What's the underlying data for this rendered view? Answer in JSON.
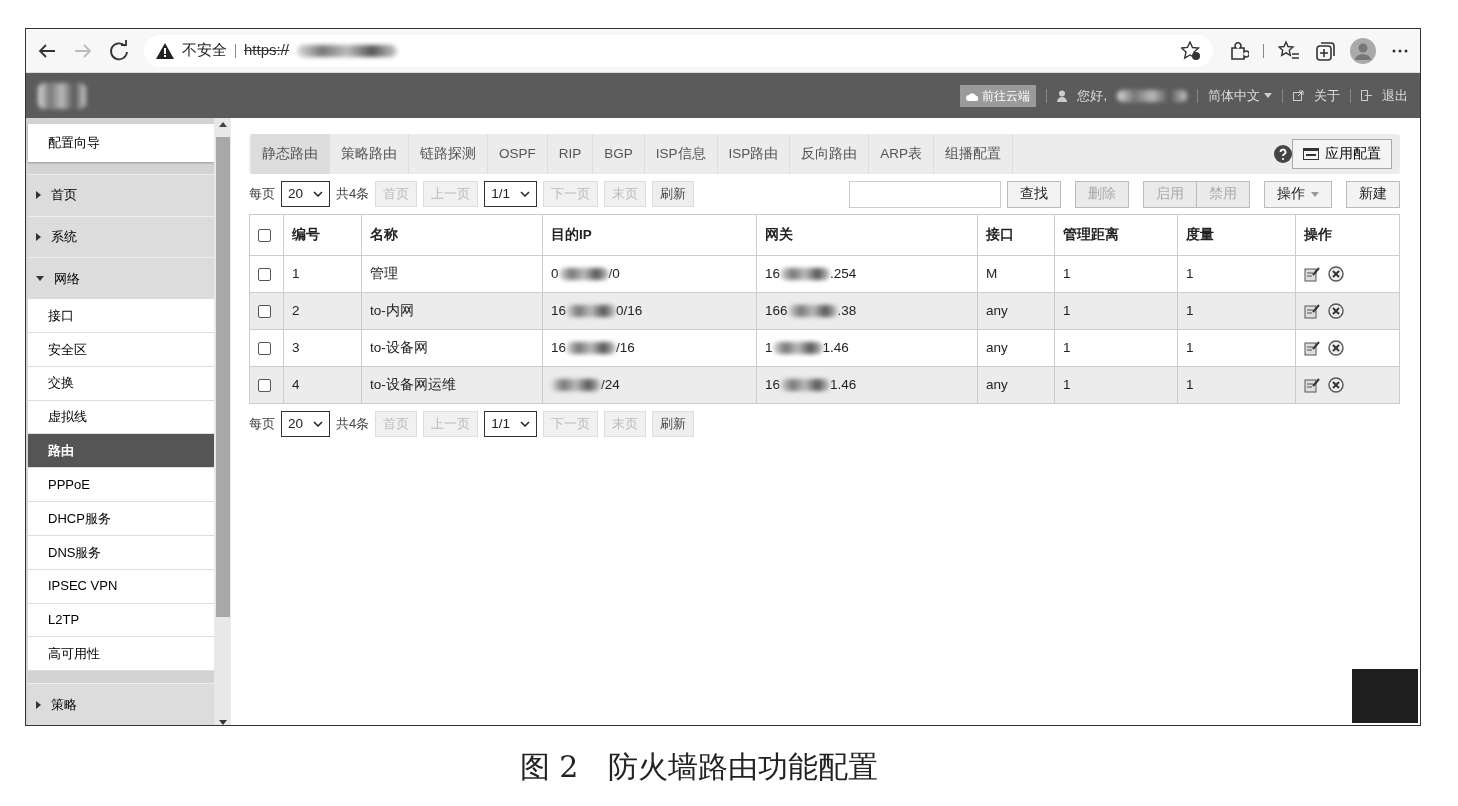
{
  "browser": {
    "forward_disabled": true,
    "security_label": "不安全",
    "url": "https://"
  },
  "header": {
    "cloud_button": "前往云端",
    "greeting": "您好,",
    "language": "简体中文",
    "about": "关于",
    "logout": "退出"
  },
  "sidebar": {
    "items": [
      {
        "label": "配置向导",
        "kind": "wizard"
      },
      {
        "label": "首页",
        "kind": "group",
        "expanded": false
      },
      {
        "label": "系统",
        "kind": "group",
        "expanded": false
      },
      {
        "label": "网络",
        "kind": "group",
        "expanded": true,
        "children": [
          {
            "label": "接口",
            "selected": false
          },
          {
            "label": "安全区",
            "selected": false
          },
          {
            "label": "交换",
            "selected": false
          },
          {
            "label": "虚拟线",
            "selected": false
          },
          {
            "label": "路由",
            "selected": true
          },
          {
            "label": "PPPoE",
            "selected": false
          },
          {
            "label": "DHCP服务",
            "selected": false
          },
          {
            "label": "DNS服务",
            "selected": false
          },
          {
            "label": "IPSEC VPN",
            "selected": false
          },
          {
            "label": "L2TP",
            "selected": false
          },
          {
            "label": "高可用性",
            "selected": false
          }
        ]
      },
      {
        "label": "策略",
        "kind": "group",
        "expanded": false
      }
    ]
  },
  "tabs": [
    {
      "label": "静态路由",
      "selected": true
    },
    {
      "label": "策略路由",
      "selected": false
    },
    {
      "label": "链路探测",
      "selected": false
    },
    {
      "label": "OSPF",
      "selected": false
    },
    {
      "label": "RIP",
      "selected": false
    },
    {
      "label": "BGP",
      "selected": false
    },
    {
      "label": "ISP信息",
      "selected": false
    },
    {
      "label": "ISP路由",
      "selected": false
    },
    {
      "label": "反向路由",
      "selected": false
    },
    {
      "label": "ARP表",
      "selected": false
    },
    {
      "label": "组播配置",
      "selected": false
    }
  ],
  "apply_button": "应用配置",
  "pagers": [
    {
      "per_page_label": "每页",
      "per_page": "20",
      "total": "共4条",
      "page": "1/1",
      "buttons": [
        {
          "label": "首页",
          "disabled": true
        },
        {
          "label": "上一页",
          "disabled": true
        },
        {
          "label": "下一页",
          "disabled": true
        },
        {
          "label": "末页",
          "disabled": true
        },
        {
          "label": "刷新",
          "disabled": false
        }
      ]
    },
    {
      "per_page_label": "每页",
      "per_page": "20",
      "total": "共4条",
      "page": "1/1",
      "buttons": [
        {
          "label": "首页",
          "disabled": true
        },
        {
          "label": "上一页",
          "disabled": true
        },
        {
          "label": "下一页",
          "disabled": true
        },
        {
          "label": "末页",
          "disabled": true
        },
        {
          "label": "刷新",
          "disabled": false
        }
      ]
    }
  ],
  "actions": [
    {
      "label": "查找",
      "disabled": false,
      "kind": "button"
    },
    {
      "label": "删除",
      "disabled": true,
      "kind": "button"
    },
    {
      "label": "启用",
      "disabled": true,
      "kind": "group"
    },
    {
      "label": "禁用",
      "disabled": true,
      "kind": "group"
    },
    {
      "label": "操作",
      "disabled": false,
      "kind": "dropdown"
    },
    {
      "label": "新建",
      "disabled": false,
      "kind": "button"
    }
  ],
  "table": {
    "select_all_checked": false,
    "columns": [
      "编号",
      "名称",
      "目的IP",
      "网关",
      "接口",
      "管理距离",
      "度量",
      "操作"
    ],
    "rows": [
      {
        "checked": false,
        "number": "1",
        "name": "管理",
        "destination": {
          "start": "0",
          "end": "/0"
        },
        "gateway": {
          "start": "16",
          "end": ".254"
        },
        "interface": "M",
        "distance": "1",
        "metric": "1"
      },
      {
        "checked": false,
        "number": "2",
        "name": "to-内网",
        "destination": {
          "start": "16",
          "end": "0/16"
        },
        "gateway": {
          "start": "166",
          "end": ".38"
        },
        "interface": "any",
        "distance": "1",
        "metric": "1"
      },
      {
        "checked": false,
        "number": "3",
        "name": "to-设备网",
        "destination": {
          "start": "16",
          "end": "/16"
        },
        "gateway": {
          "start": "1",
          "end": "1.46"
        },
        "interface": "any",
        "distance": "1",
        "metric": "1"
      },
      {
        "checked": false,
        "number": "4",
        "name": "to-设备网运维",
        "destination": {
          "end": "/24"
        },
        "gateway": {
          "start": "16",
          "end": "1.46"
        },
        "interface": "any",
        "distance": "1",
        "metric": "1"
      }
    ]
  },
  "caption": "图 2　防火墙路由功能配置"
}
